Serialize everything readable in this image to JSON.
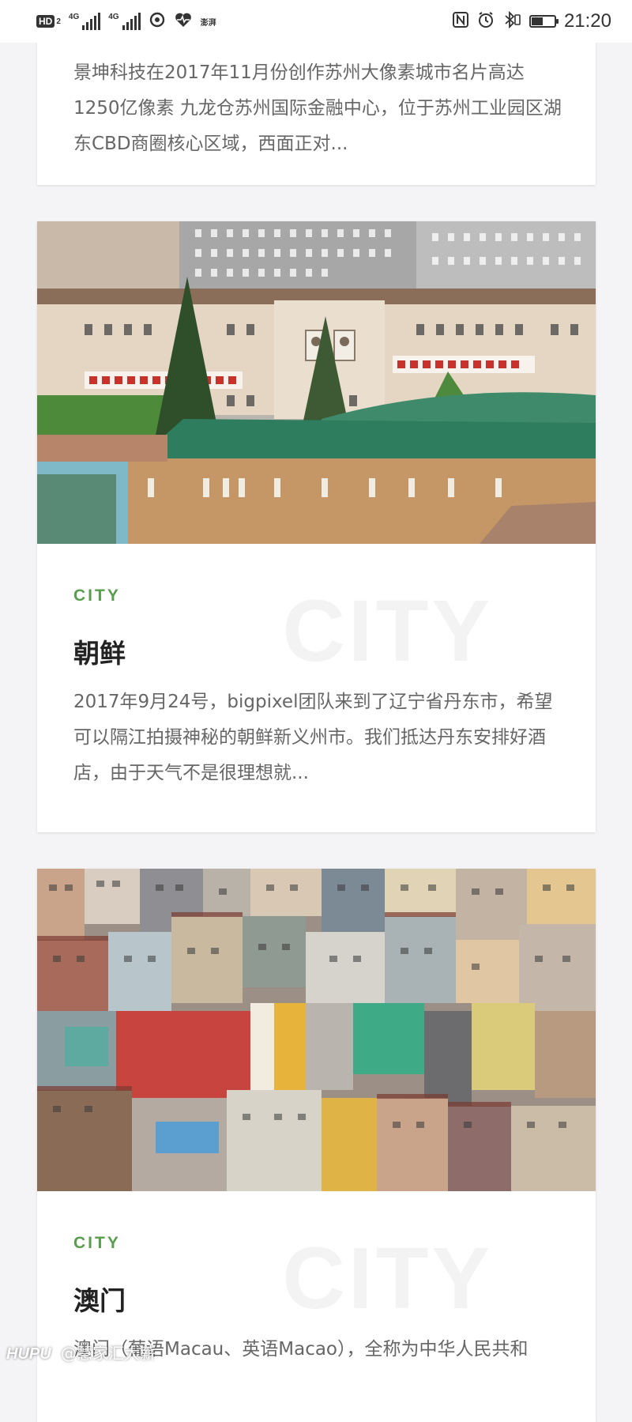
{
  "status_bar": {
    "hd_label": "HD",
    "hd_sub": "2",
    "network_1": "4G",
    "network_2": "4G",
    "app_label": "澎湃",
    "time": "21:20",
    "battery_level": 0.5
  },
  "articles": [
    {
      "excerpt": "景坤科技在2017年11月份创作苏州大像素城市名片高达1250亿像素 九龙仓苏州国际金融中心，位于苏州工业园区湖东CBD商圈核心区域，西面正对..."
    },
    {
      "category": "CITY",
      "watermark": "CITY",
      "title": "朝鲜",
      "excerpt": "2017年9月24号，bigpixel团队来到了辽宁省丹东市，希望可以隔江拍摄神秘的朝鲜新义州市。我们抵达丹东安排好酒店，由于天气不是很理想就..."
    },
    {
      "category": "CITY",
      "watermark": "CITY",
      "title": "澳门",
      "excerpt": "澳门（葡语Macau、英语Macao），全称为中华人民共和"
    }
  ],
  "footer_watermark": {
    "brand": "HUPU",
    "user": "@慧家汇大薪"
  },
  "colors": {
    "accent": "#5a9d4f",
    "background": "#f4f4f6",
    "card": "#ffffff",
    "title": "#222222",
    "body_text": "#666666"
  }
}
